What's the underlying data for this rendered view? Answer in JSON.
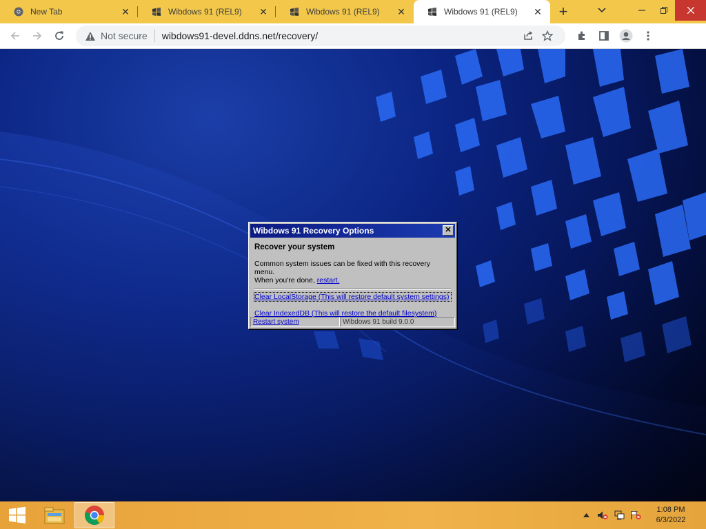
{
  "browser": {
    "tabs": [
      {
        "title": "New Tab",
        "icon": "chrome-icon",
        "active": false
      },
      {
        "title": "Wibdows 91 (REL9)",
        "icon": "wibdows-icon",
        "active": false
      },
      {
        "title": "Wibdows 91 (REL9)",
        "icon": "wibdows-icon",
        "active": false
      },
      {
        "title": "Wibdows 91 (REL9)",
        "icon": "wibdows-icon",
        "active": true
      }
    ],
    "new_tab_label": "+",
    "security_label": "Not secure",
    "url": "wibdows91-devel.ddns.net/recovery/",
    "colors": {
      "tabstrip": "#f3c84a",
      "close_button": "#c7372f"
    }
  },
  "dialog": {
    "title": "Wibdows 91 Recovery Options",
    "close_label": "✕",
    "heading": "Recover your system",
    "description_line1": "Common system issues can be fixed with this recovery menu.",
    "description_line2": "When you're done, ",
    "restart_link": "restart.",
    "options": [
      "Clear LocalStorage (This will restore default system settings)",
      "Clear IndexedDB (This will restore the default filesystem)"
    ],
    "status_restart": "Restart system",
    "status_build": "Wibdows 91 build 9.0.0"
  },
  "taskbar": {
    "time": "1:08 PM",
    "date": "6/3/2022",
    "apps": [
      "file-explorer-icon",
      "chrome-icon"
    ]
  }
}
